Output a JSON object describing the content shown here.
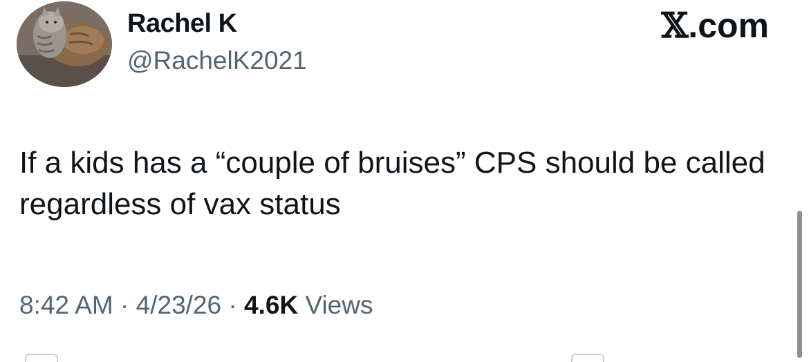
{
  "author": {
    "display_name": "Rachel K",
    "handle": "@RachelK2021",
    "avatar_icon": "cat-photo-avatar"
  },
  "brand": {
    "x_glyph": "𝕏",
    "suffix": ".com"
  },
  "tweet": {
    "text": "If a kids has a “couple of bruises” CPS should be called regardless of vax status",
    "time": "8:42 AM",
    "date": "4/23/26",
    "separator": "·",
    "views_count": "4.6K",
    "views_label": "Views"
  },
  "colors": {
    "text_primary": "#0f1419",
    "text_secondary": "#536471",
    "background": "#ffffff"
  }
}
